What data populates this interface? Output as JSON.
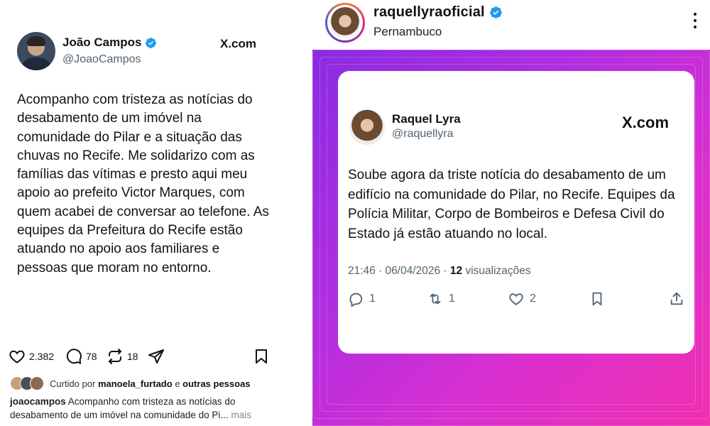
{
  "left_post": {
    "author_name": "João Campos",
    "author_handle": "@JoaoCampos",
    "source": "X.com",
    "text": "Acompanho com tristeza as notícias do desabamento de um imóvel na comunidade do Pilar e a situação das chuvas no Recife. Me solidarizo com as famílias das vítimas e presto aqui meu apoio ao prefeito Victor Marques, com quem acabei de conversar ao telefone. As equipes da Prefeitura do Recife estão atuando no apoio aos familiares e pessoas que moram no entorno.",
    "likes": "2.382",
    "comments": "78",
    "reposts": "18",
    "liked_by_prefix": "Curtido por",
    "liked_by_user": "manoela_furtado",
    "liked_by_connector": "e",
    "liked_by_others": "outras pessoas",
    "caption_user": "joaocampos",
    "caption_text": "Acompanho com tristeza as notícias do desabamento de um imóvel na comunidade do Pi...",
    "caption_more": "mais"
  },
  "right_post": {
    "ig_username": "raquellyraoficial",
    "ig_location": "Pernambuco",
    "tweet": {
      "author_name": "Raquel Lyra",
      "author_handle": "@raquellyra",
      "source": "X.com",
      "text": "Soube agora da triste notícia do desabamento de um edifício na comunidade do Pilar, no Recife. Equipes da Polícia Militar, Corpo de Bombeiros e Defesa Civil do Estado já estão atuando no local.",
      "time_date": "21:46 · 06/04/2026 ·",
      "views_count": "12",
      "views_label": "visualizações",
      "replies": "1",
      "retweets": "1",
      "likes": "2"
    }
  },
  "colors": {
    "verified_blue": "#1d9bf0",
    "bg_gradient_start": "#8a2be2",
    "bg_gradient_end": "#f030b0"
  },
  "icons": [
    "verified-icon",
    "heart-icon",
    "comment-icon",
    "repost-icon",
    "share-icon",
    "bookmark-icon",
    "kebab-menu-icon",
    "reply-icon",
    "retweet-icon",
    "upload-icon"
  ]
}
